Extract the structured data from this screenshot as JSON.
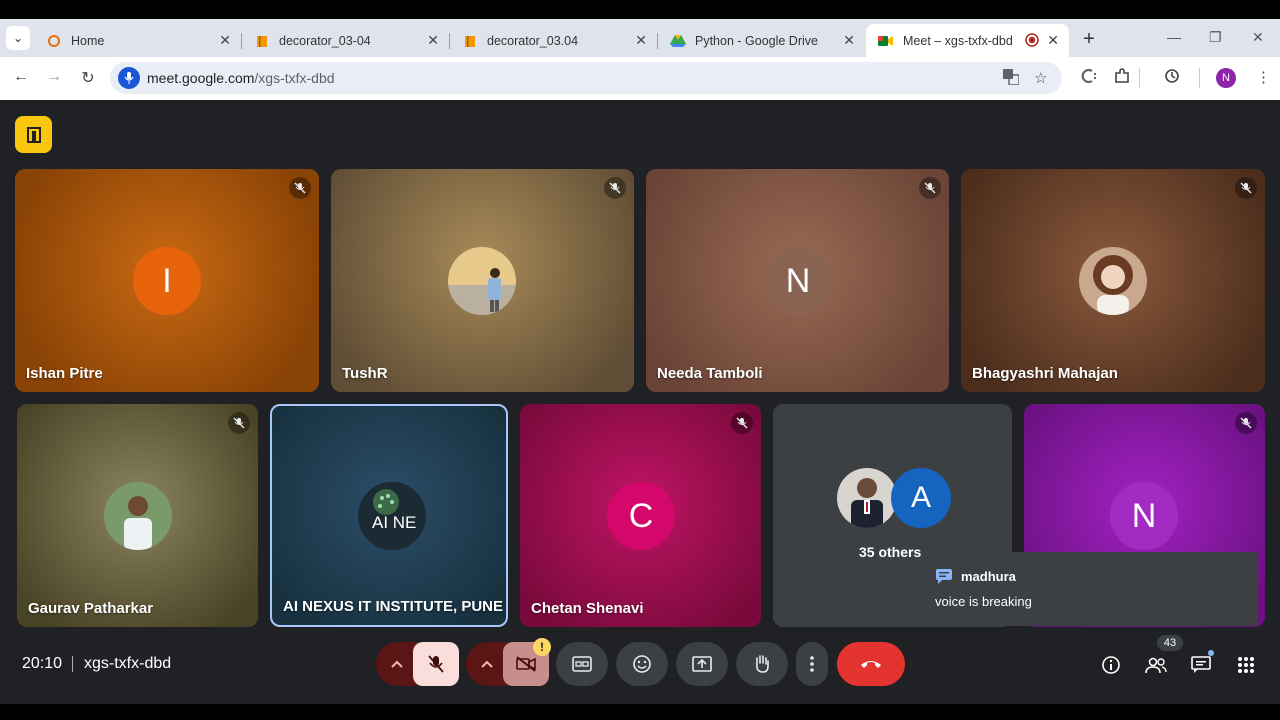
{
  "browser": {
    "tabs": [
      {
        "label": "Home"
      },
      {
        "label": "decorator_03-04"
      },
      {
        "label": "decorator_03.04"
      },
      {
        "label": "Python - Google Drive"
      },
      {
        "label": "Meet – xgs-txfx-dbd"
      }
    ],
    "url_host": "meet.google.com",
    "url_path": "/xgs-txfx-dbd",
    "profile_initial": "N"
  },
  "participants_top": [
    {
      "name": "Ishan Pitre",
      "initial": "I"
    },
    {
      "name": "TushR"
    },
    {
      "name": "Needa Tamboli",
      "initial": "N"
    },
    {
      "name": "Bhagyashri Mahajan"
    }
  ],
  "participants_bottom": [
    {
      "name": "Gaurav Patharkar"
    },
    {
      "name": "AI NEXUS IT INSTITUTE, PUNE",
      "logo_text": "AI NE"
    },
    {
      "name": "Chetan Shenavi",
      "initial": "C"
    },
    {
      "name": "",
      "initial": "N"
    }
  ],
  "others": {
    "label": "35 others",
    "initial": "A"
  },
  "chat_toast": {
    "sender": "madhura",
    "message": "voice is breaking"
  },
  "bottom_bar": {
    "time": "20:10",
    "meeting_code": "xgs-txfx-dbd",
    "participant_count": "43"
  },
  "colors": {
    "accent_red": "#e3342f",
    "layout_yellow": "#f9c80e",
    "meet_bg": "#202124"
  }
}
